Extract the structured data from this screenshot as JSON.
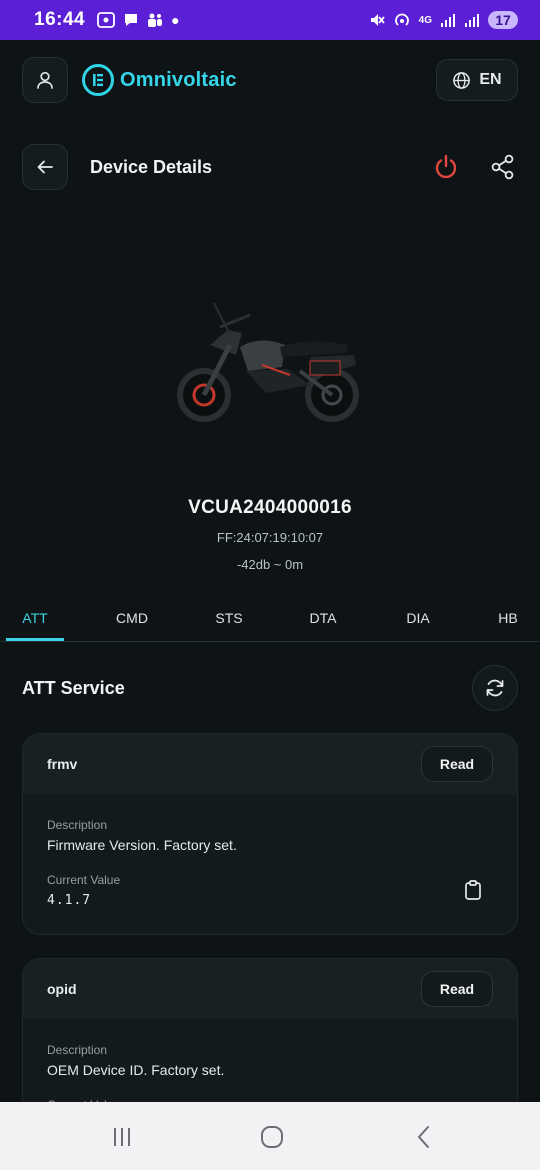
{
  "status_bar": {
    "time": "16:44",
    "network": "4G",
    "battery": "17"
  },
  "app_bar": {
    "brand": "Omnivoltaic",
    "language": "EN"
  },
  "page_header": {
    "title": "Device Details"
  },
  "device": {
    "id": "VCUA2404000016",
    "mac": "FF:24:07:19:10:07",
    "rssi_distance": "-42db ~ 0m"
  },
  "tabs": [
    "ATT",
    "CMD",
    "STS",
    "DTA",
    "DIA",
    "HB"
  ],
  "active_tab": "ATT",
  "service": {
    "title": "ATT Service"
  },
  "attributes": [
    {
      "name": "frmv",
      "read_label": "Read",
      "description_label": "Description",
      "description": "Firmware Version. Factory set.",
      "current_value_label": "Current Value",
      "current_value": "4.1.7"
    },
    {
      "name": "opid",
      "read_label": "Read",
      "description_label": "Description",
      "description": "OEM Device ID. Factory set.",
      "current_value_label": "Current Value"
    }
  ],
  "colors": {
    "status_bar": "#5b1fd6",
    "background": "#0e1416",
    "accent": "#3ed3e4",
    "power_icon": "#e0483e"
  },
  "icons": {
    "profile": "person-icon",
    "language": "globe-icon",
    "back": "arrow-left-icon",
    "power": "power-icon",
    "share": "share-icon",
    "refresh": "refresh-icon",
    "copy": "clipboard-icon"
  }
}
